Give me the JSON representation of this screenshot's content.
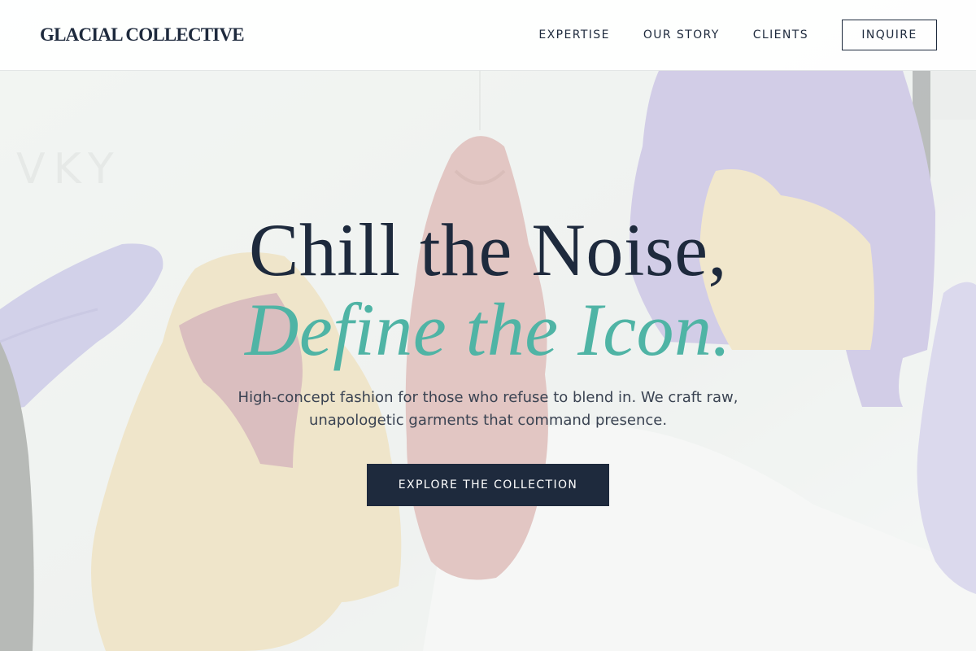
{
  "brand": {
    "logo_text": "GLACIAL COLLECTIVE"
  },
  "nav": {
    "links": [
      "EXPERTISE",
      "OUR STORY",
      "CLIENTS"
    ],
    "inquire_label": "INQUIRE"
  },
  "hero": {
    "headline_line_1": "Chill the Noise,",
    "headline_line_2": "Define the Icon.",
    "subtitle": "High-concept fashion for those who refuse to blend in. We craft raw, unapologetic garments that command presence.",
    "cta_label": "EXPLORE THE COLLECTION",
    "background_image": "hanging-jackets-photo"
  },
  "colors": {
    "navy": "#1e2a3d",
    "teal": "#4fb4a5",
    "header_bg": "#ffffff",
    "text_muted": "#3a4352"
  }
}
